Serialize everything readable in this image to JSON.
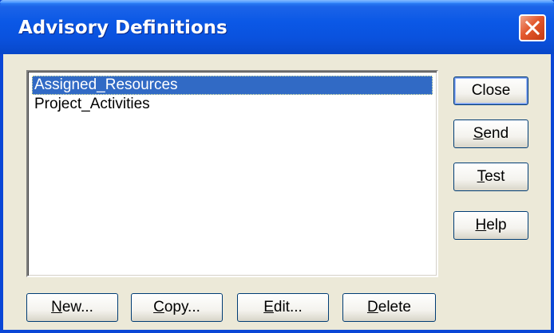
{
  "window": {
    "title": "Advisory Definitions"
  },
  "list": {
    "items": [
      {
        "label": "Assigned_Resources",
        "selected": true
      },
      {
        "label": "Project_Activities",
        "selected": false
      }
    ]
  },
  "side_buttons": {
    "close": {
      "label": "Close",
      "mnemonic": ""
    },
    "send": {
      "label": "Send",
      "mnemonic": "S"
    },
    "test": {
      "label": "Test",
      "mnemonic": "T"
    },
    "help": {
      "label": "Help",
      "mnemonic": "H"
    }
  },
  "bottom_buttons": {
    "new": {
      "label": "New...",
      "mnemonic": "N"
    },
    "copy": {
      "label": "Copy...",
      "mnemonic": "C"
    },
    "edit": {
      "label": "Edit...",
      "mnemonic": "E"
    },
    "delete": {
      "label": "Delete",
      "mnemonic": "D"
    }
  },
  "colors": {
    "titlebar": "#0a52de",
    "selection": "#316ac5",
    "close_button": "#e3582d",
    "dialog_face": "#ece9d8"
  }
}
